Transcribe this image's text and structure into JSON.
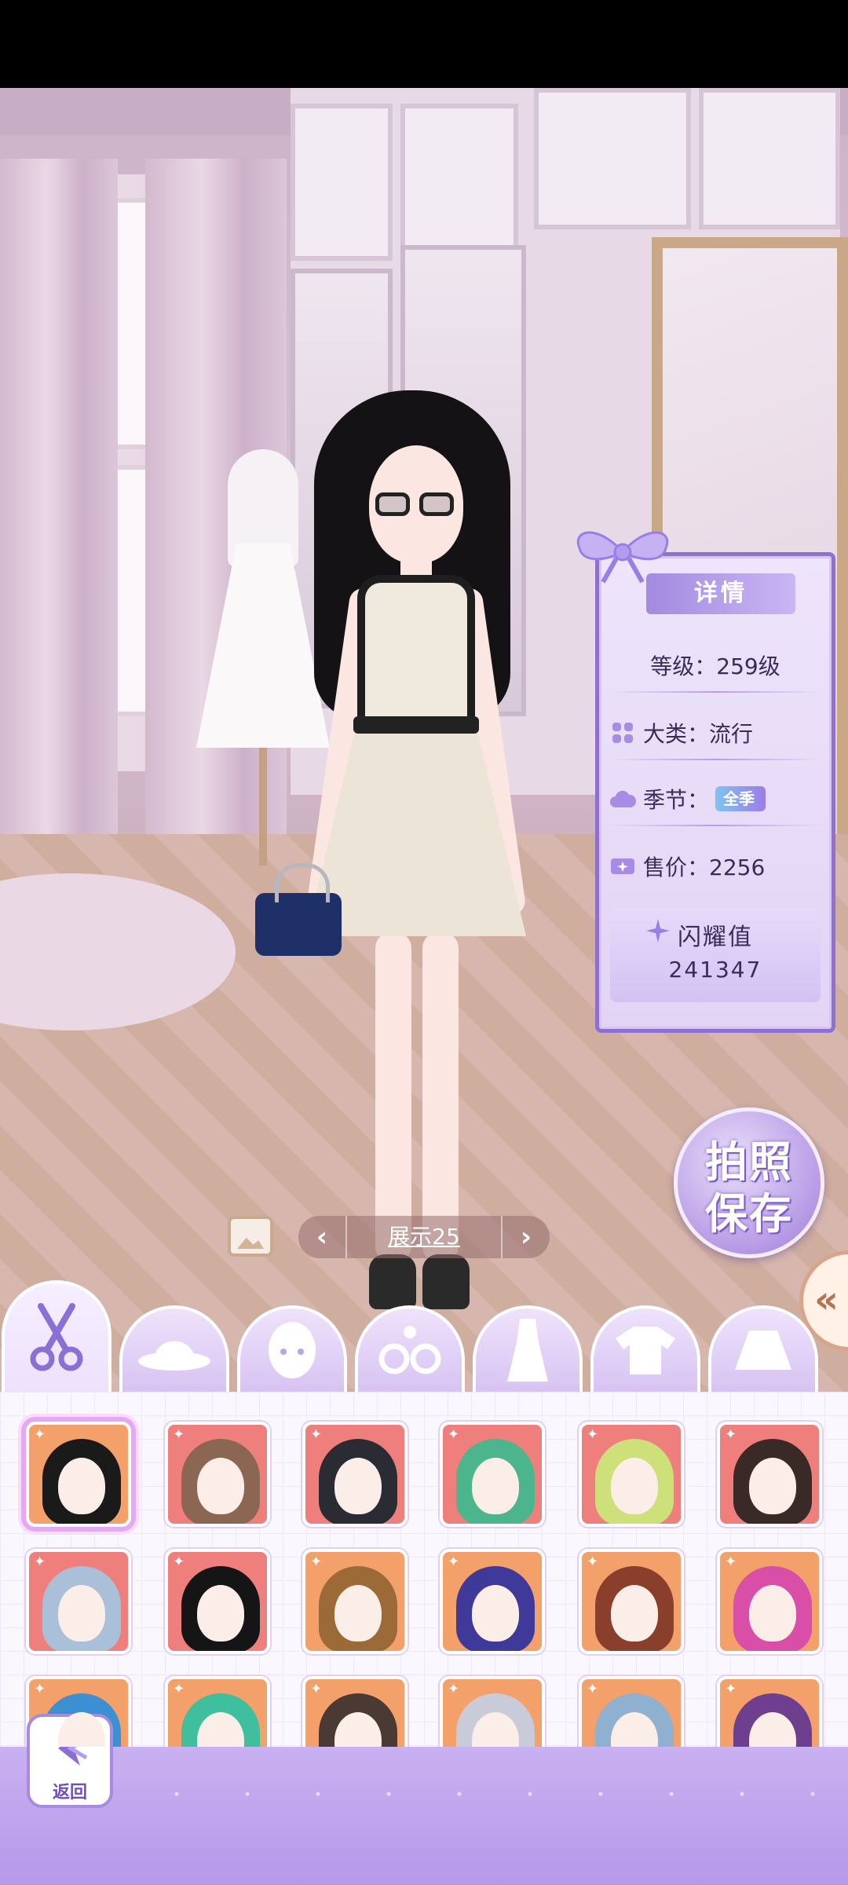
{
  "detail_panel": {
    "title": "详情",
    "level": "等级：259级",
    "category": "大类：流行",
    "season_label": "季节：",
    "season_tag": "全季",
    "price": "售价：2256",
    "shine_label": "闪耀值",
    "shine_value": "241347"
  },
  "photo_save": {
    "line1": "拍照",
    "line2": "保存"
  },
  "display_selector": {
    "prev": "‹",
    "label": "展示25",
    "next": "›"
  },
  "collapse_button": "«",
  "tabs": [
    {
      "icon": "scissors-icon",
      "active": true
    },
    {
      "icon": "hat-icon",
      "active": false
    },
    {
      "icon": "face-icon",
      "active": false
    },
    {
      "icon": "earrings-icon",
      "active": false
    },
    {
      "icon": "dress-icon",
      "active": false
    },
    {
      "icon": "shirt-icon",
      "active": false
    },
    {
      "icon": "skirt-icon",
      "active": false
    }
  ],
  "back_button": {
    "label": "返回"
  },
  "colors": {
    "accent": "#9a7ee8",
    "panel_border": "#8f6fcf",
    "item_bg_orange": "#f4a06b",
    "item_bg_red": "#ee7f7d"
  }
}
